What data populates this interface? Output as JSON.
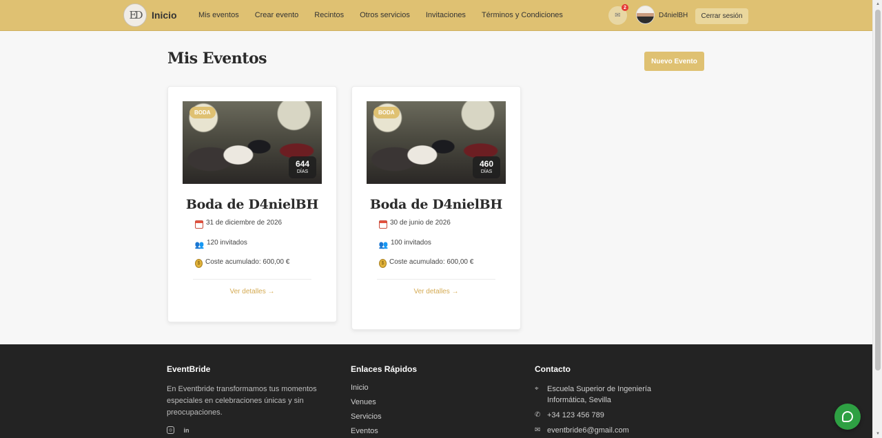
{
  "nav": {
    "logo_text": "ED",
    "brand": "Inicio",
    "links": [
      "Mis eventos",
      "Crear evento",
      "Recintos",
      "Otros servicios",
      "Invitaciones",
      "Términos y Condiciones"
    ],
    "notification_count": "2",
    "username": "D4nielBH",
    "logout_label": "Cerrar sesión"
  },
  "main": {
    "title": "Mis Eventos",
    "new_event_label": "Nuevo Evento",
    "events": [
      {
        "tag": "BODA",
        "days": "644",
        "days_label": "DÍAS",
        "title": "Boda de D4nielBH",
        "date": "31 de diciembre de 2026",
        "guests": "120 invitados",
        "cost": "Coste acumulado: 600,00 €",
        "details_label": "Ver detalles →"
      },
      {
        "tag": "BODA",
        "days": "460",
        "days_label": "DÍAS",
        "title": "Boda de D4nielBH",
        "date": "30 de junio de 2026",
        "guests": "100 invitados",
        "cost": "Coste acumulado: 600,00 €",
        "details_label": "Ver detalles →"
      }
    ]
  },
  "footer": {
    "about": {
      "heading": "EventBride",
      "text": "En Eventbride transformamos tus momentos especiales en celebraciones únicas y sin preocupaciones."
    },
    "links": {
      "heading": "Enlaces Rápidos",
      "items": [
        "Inicio",
        "Venues",
        "Servicios",
        "Eventos"
      ]
    },
    "contact": {
      "heading": "Contacto",
      "address": "Escuela Superior de Ingeniería Informática, Sevilla",
      "phone": "+34 123 456 789",
      "email": "eventbride6@gmail.com"
    }
  },
  "colors": {
    "accent": "#dfc172",
    "footer_bg": "#232323",
    "chat": "#2ea043"
  }
}
